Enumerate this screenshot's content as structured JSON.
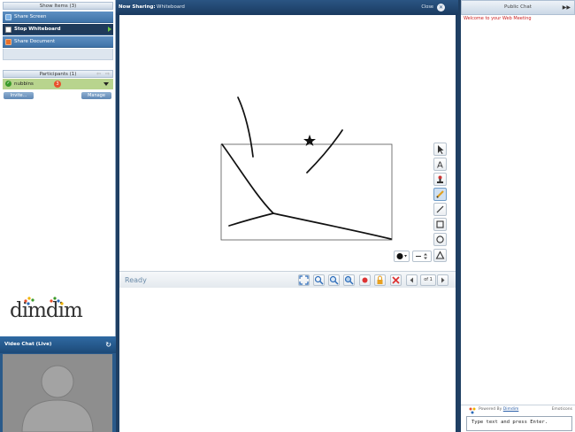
{
  "left_panel": {
    "show_items_label": "Show Items (3)",
    "share_items": [
      {
        "label": "Share Screen",
        "icon": "screen-icon",
        "color": "#7db2e6"
      },
      {
        "label": "Stop Whiteboard",
        "icon": "whiteboard-icon",
        "color": "#ffffff"
      },
      {
        "label": "Share Document",
        "icon": "document-icon",
        "color": "#e8702a"
      }
    ],
    "participants_label": "Participants (1)",
    "participant": {
      "name": "nubbins",
      "badge": "3"
    },
    "invite_label": "Invite...",
    "manage_label": "Manage",
    "logo_text": "dimdim",
    "video_chat_label": "Video Chat (Live)"
  },
  "center": {
    "now_sharing_label": "Now Sharing:",
    "sharing_item": "Whiteboard",
    "close_label": "Close",
    "status_text": "Ready",
    "page_label": "of 1"
  },
  "right_panel": {
    "title": "Public Chat",
    "welcome_message": "Welcome to your Web Meeting",
    "powered_by_label": "Powered By",
    "powered_by_link": "Dimdim",
    "emoticons_label": "Emoticons",
    "chat_input_value": "Type text and press Enter."
  },
  "colors": {
    "panel_blue": "#1f3f63",
    "participant_green": "#b8d48e",
    "welcome_red": "#cc2222"
  }
}
